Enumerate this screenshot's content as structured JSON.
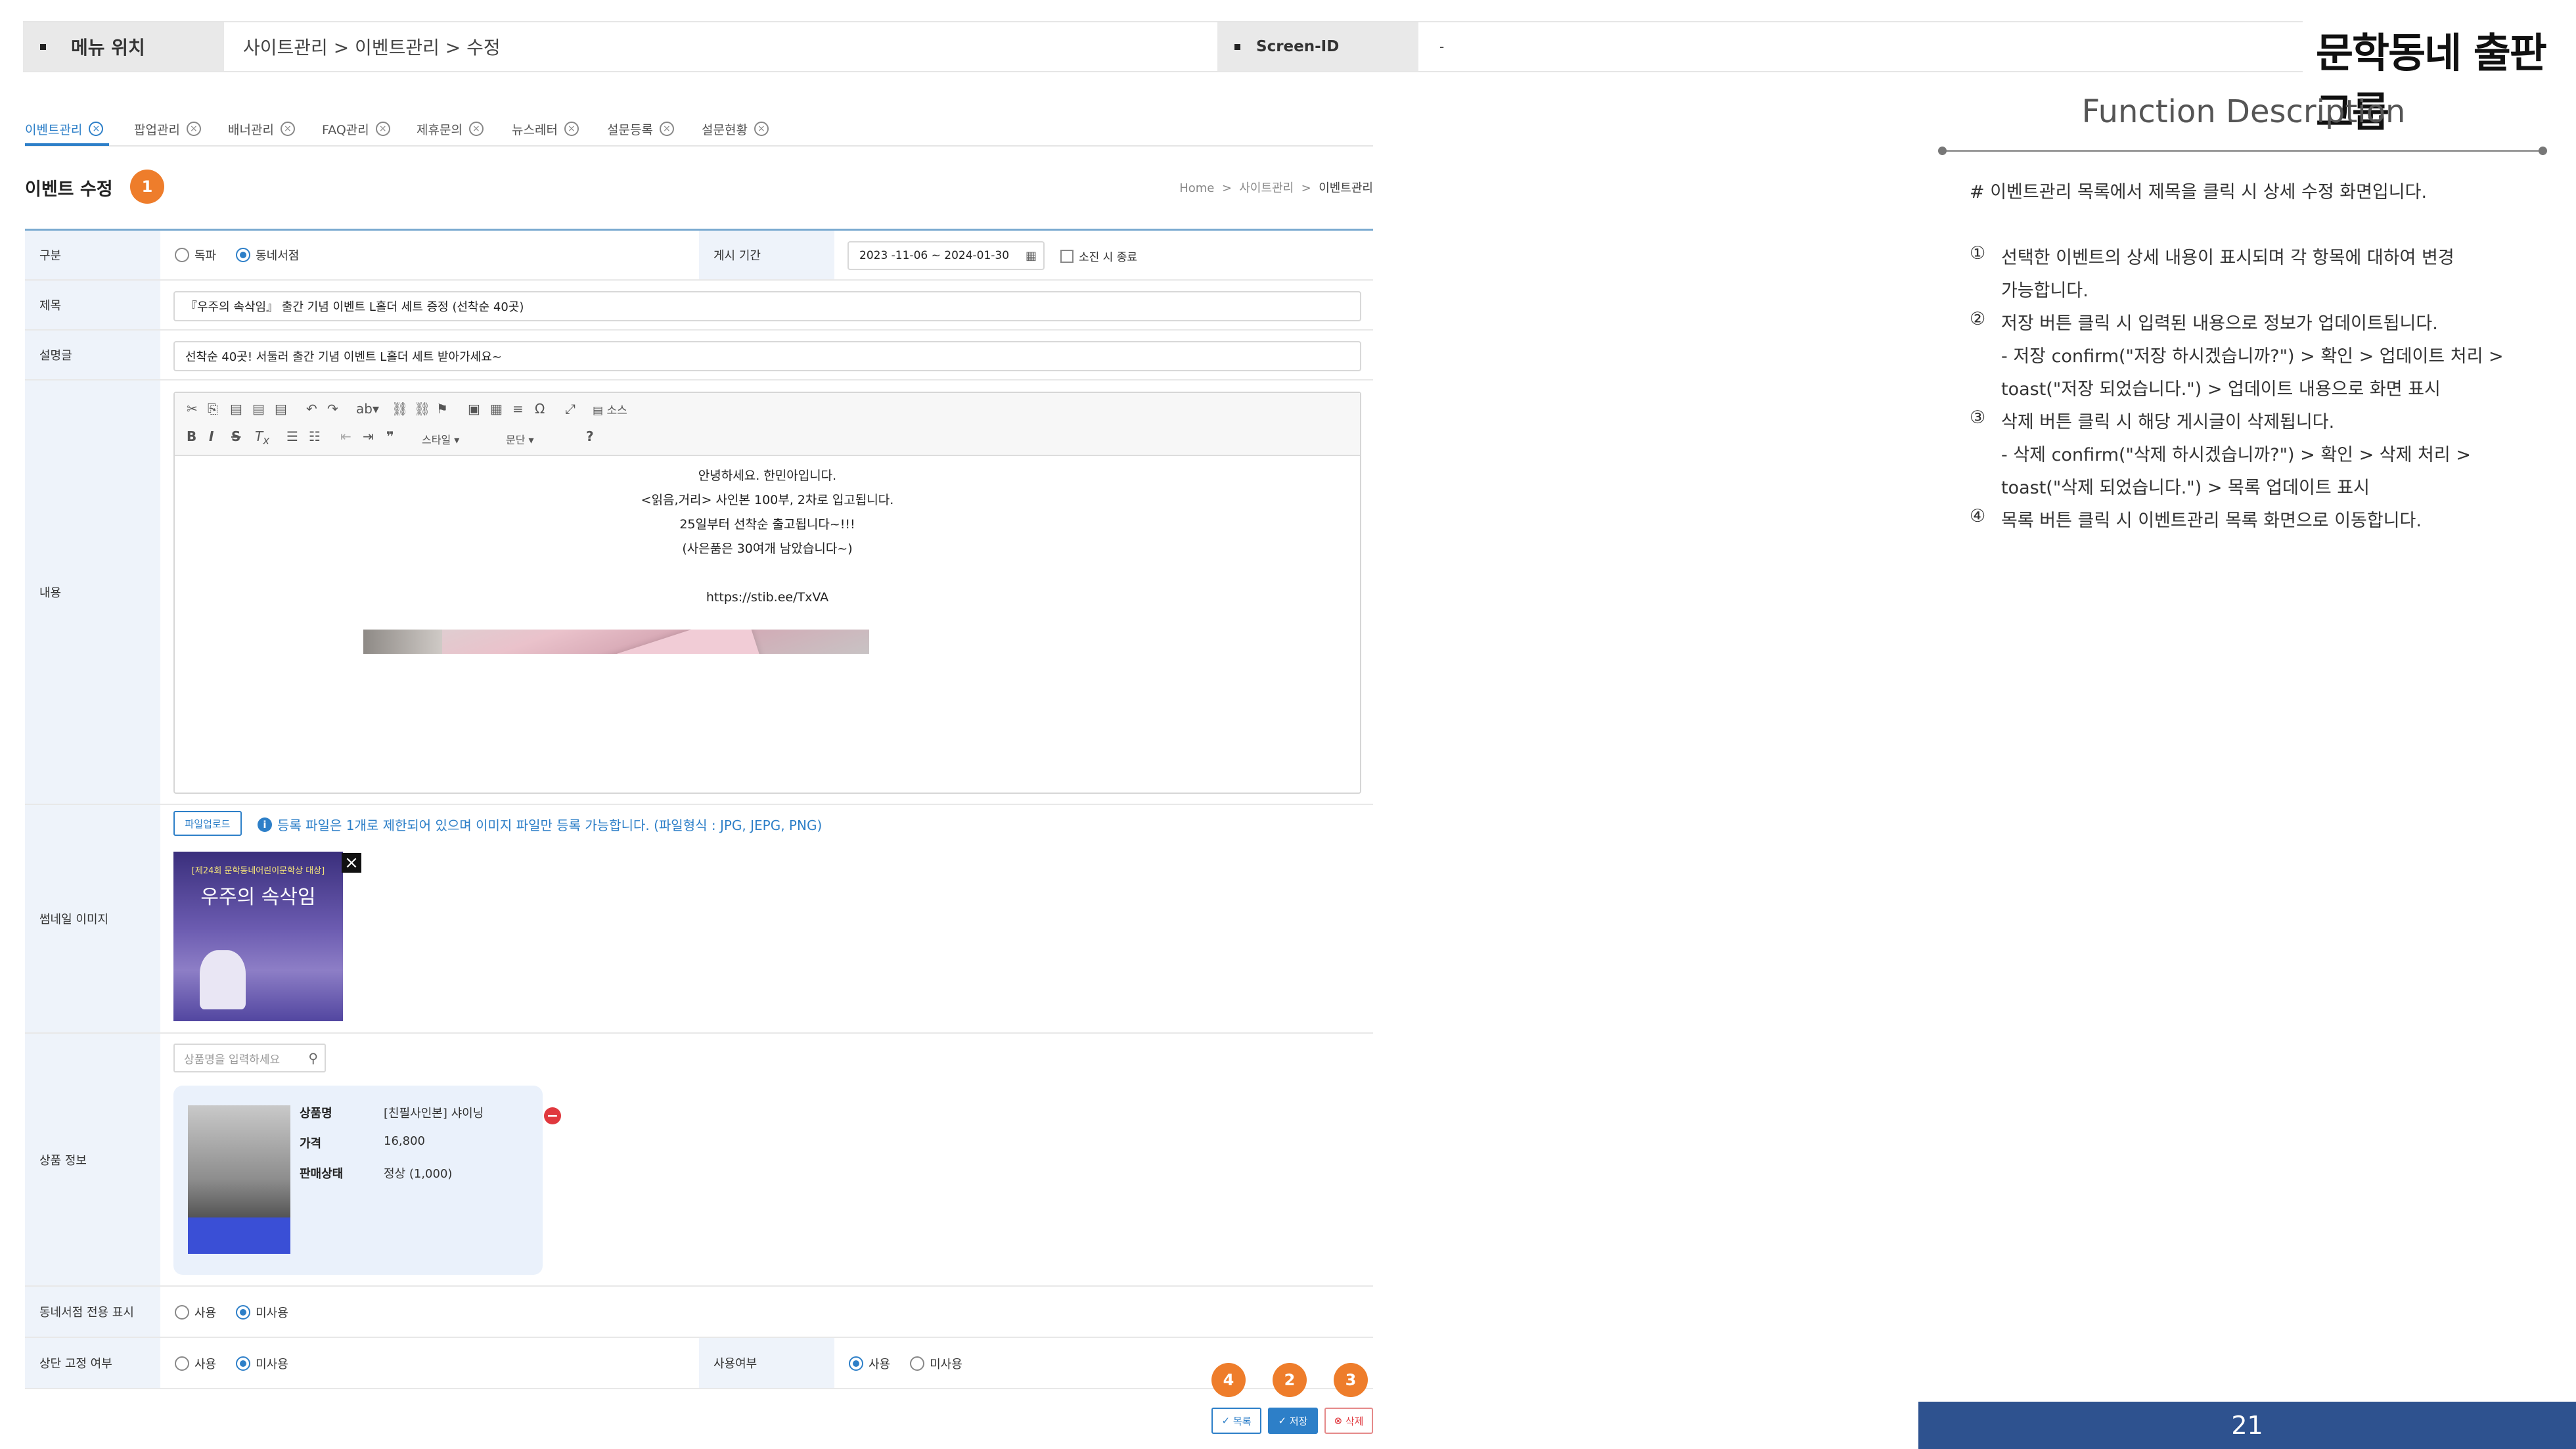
{
  "header": {
    "menu_label": "메뉴 위치",
    "menu_path": "사이트관리 > 이벤트관리 > 수정",
    "screen_id_label": "Screen-ID",
    "screen_id_value": "-",
    "logo": "문학동네 출판그룹"
  },
  "tabs": [
    {
      "label": "이벤트관리",
      "active": true
    },
    {
      "label": "팝업관리"
    },
    {
      "label": "배너관리"
    },
    {
      "label": "FAQ관리"
    },
    {
      "label": "제휴문의"
    },
    {
      "label": "뉴스레터"
    },
    {
      "label": "설문등록"
    },
    {
      "label": "설문현황"
    }
  ],
  "page": {
    "title": "이벤트 수정",
    "breadcrumb": [
      "Home",
      "사이트관리",
      "이벤트관리"
    ]
  },
  "form": {
    "type_label": "구분",
    "type_options": [
      "독파",
      "동네서점"
    ],
    "type_selected": "동네서점",
    "period_label": "게시 기간",
    "period_value": "2023 -11-06 ~ 2024-01-30",
    "soldout_label": "소진 시 종료",
    "title_label": "제목",
    "title_value": "『우주의 속삭임』 출간 기념 이벤트 L홀더 세트 증정 (선착순 40곳)",
    "summary_label": "설명글",
    "summary_value": "선착순 40곳! 서둘러 출간 기념 이벤트 L홀더 세트 받아가세요~",
    "content_label": "내용",
    "editor_style_label": "스타일",
    "editor_para_label": "문단",
    "editor_source_label": "소스",
    "content_lines": [
      "안녕하세요. 한민아입니다.",
      "<읽음,거리> 사인본 100부, 2차로 입고됩니다.",
      "25일부터 선착순 출고됩니다~!!!",
      "(사은품은 30여개 남았습니다~)",
      "",
      "https://stib.ee/TxVA"
    ],
    "thumb_label": "썸네일 이미지",
    "upload_button": "파일업로드",
    "upload_info": "등록 파일은 1개로 제한되어 있으며 이미지 파일만 등록 가능합니다. (파일형식 : JPG, JEPG, PNG)",
    "thumb_badge": "[제24회 문학동네어린이문학상 대상]",
    "thumb_title": "우주의 속삭임",
    "product_label": "상품 정보",
    "product_search_placeholder": "상품명을 입력하세요",
    "product": {
      "name_label": "상품명",
      "name_value": "[친필사인본] 샤이닝",
      "price_label": "가격",
      "price_value": "16,800",
      "status_label": "판매상태",
      "status_value": "정상 (1,000)"
    },
    "local_only_label": "동네서점 전용 표시",
    "pin_label": "상단 고정 여부",
    "use_label": "사용여부",
    "opt_use": "사용",
    "opt_unused": "미사용"
  },
  "buttons": {
    "list": "목록",
    "save": "저장",
    "delete": "삭제"
  },
  "badges": {
    "b1": "1",
    "b2": "2",
    "b3": "3",
    "b4": "4"
  },
  "description": {
    "title": "Function Description",
    "intro": "# 이벤트관리 목록에서 제목을 클릭 시 상세 수정 화면입니다.",
    "items": [
      {
        "num": "①",
        "lines": [
          "선택한 이벤트의 상세 내용이 표시되며 각 항목에 대하여 변경",
          "가능합니다."
        ]
      },
      {
        "num": "②",
        "lines": [
          "저장 버튼 클릭 시 입력된 내용으로 정보가 업데이트됩니다.",
          "- 저장 confirm(\"저장 하시겠습니까?\") > 확인 > 업데이트 처리 >",
          "toast(\"저장 되었습니다.\") > 업데이트 내용으로 화면 표시"
        ]
      },
      {
        "num": "③",
        "lines": [
          "삭제 버튼 클릭 시 해당 게시글이 삭제됩니다.",
          "- 삭제 confirm(\"삭제 하시겠습니까?\") > 확인 > 삭제 처리 >",
          "toast(\"삭제 되었습니다.\") > 목록 업데이트 표시"
        ]
      },
      {
        "num": "④",
        "lines": [
          "목록 버튼 클릭 시 이벤트관리 목록 화면으로 이동합니다."
        ]
      }
    ],
    "page_number": "21"
  },
  "colors": {
    "accent": "#2d7fc8",
    "badge": "#ee7d2b",
    "page_bar": "#2e528f",
    "delete": "#e0383e"
  }
}
